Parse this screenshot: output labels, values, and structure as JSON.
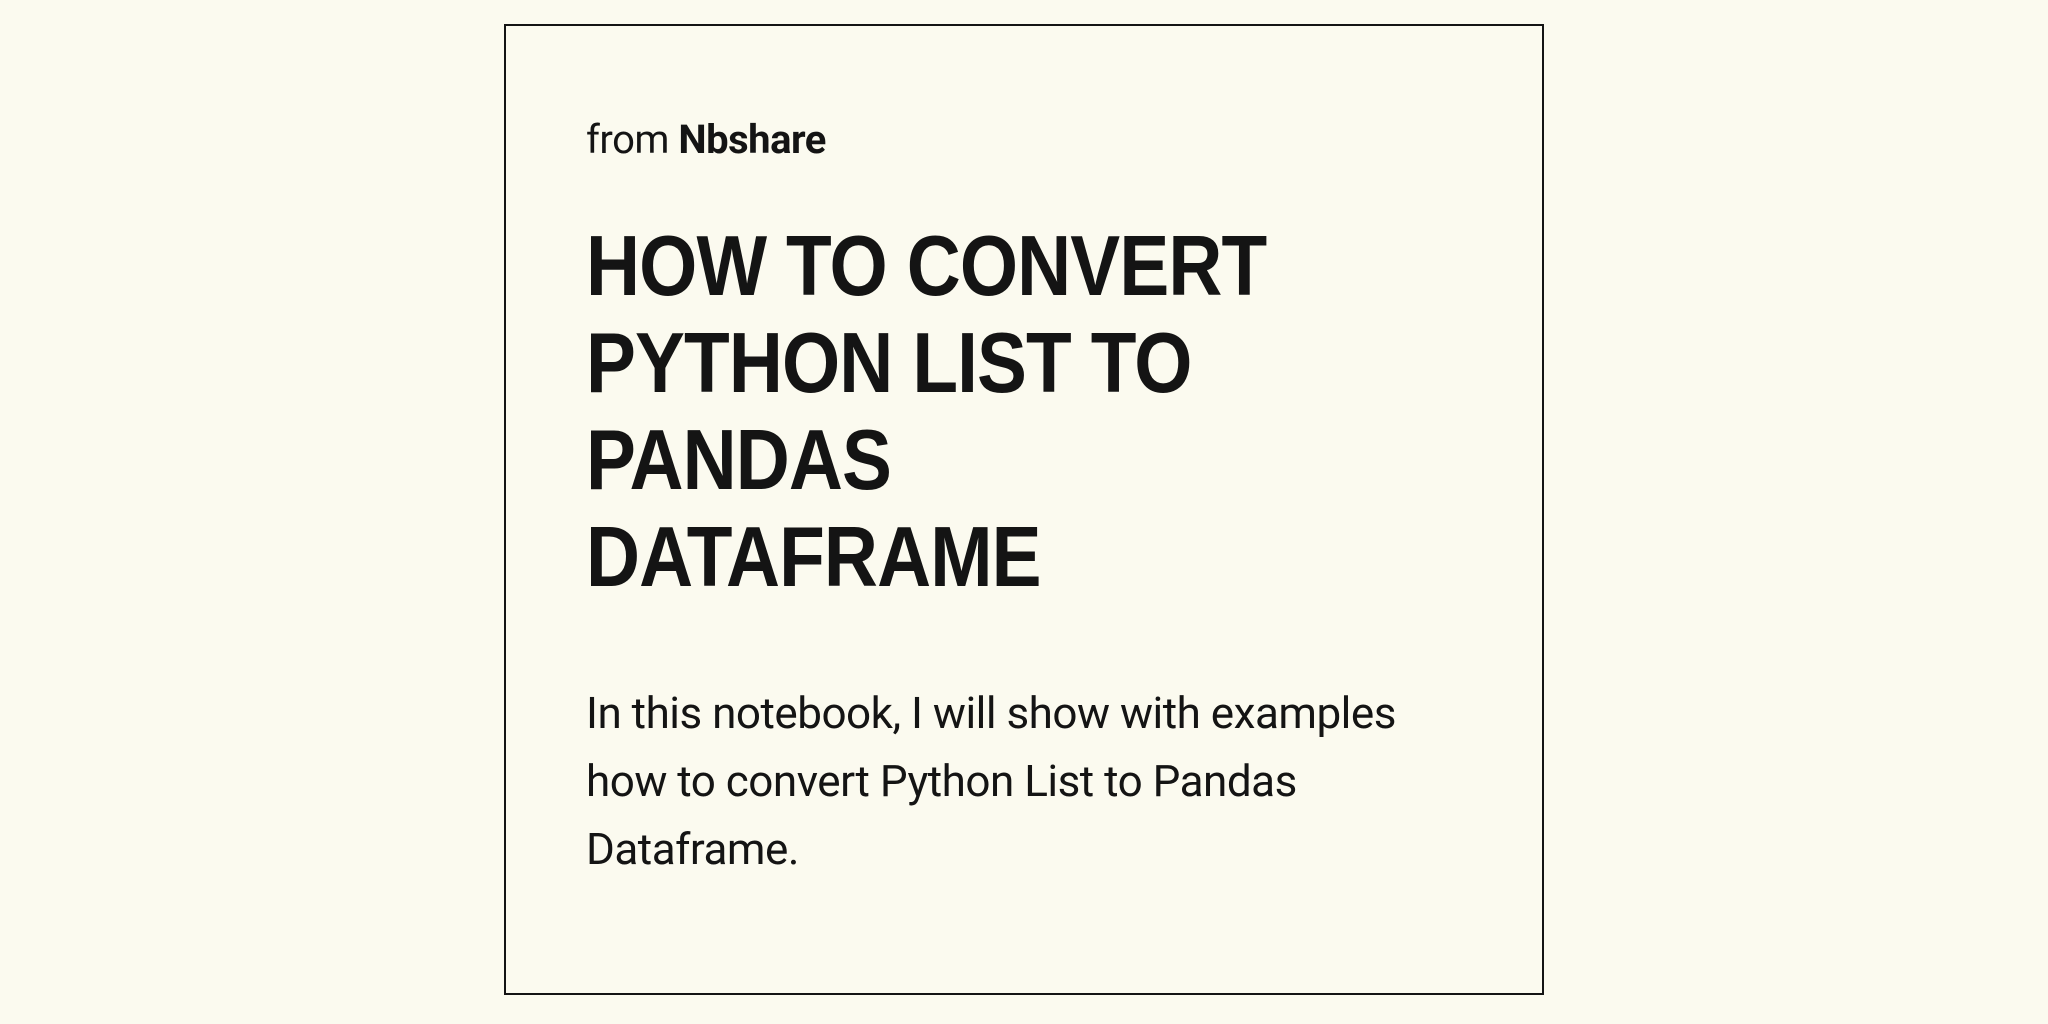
{
  "source": {
    "prefix": "from",
    "site": "Nbshare"
  },
  "title": "HOW TO CONVERT PYTHON LIST TO PANDAS DATAFRAME",
  "description": "In this notebook, I will show with examples how to convert Python List to Pandas Dataframe."
}
